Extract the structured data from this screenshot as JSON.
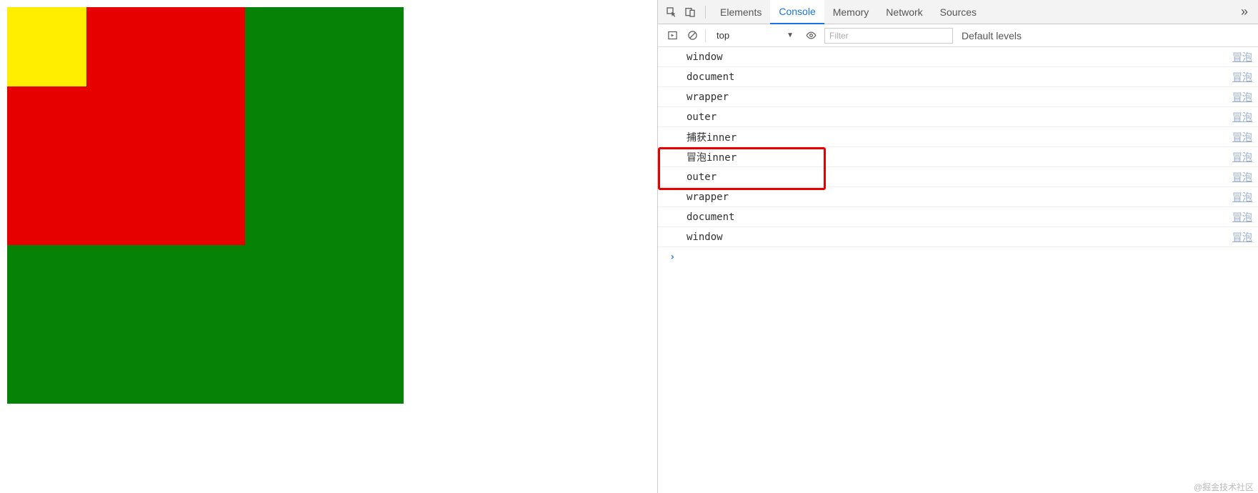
{
  "page": {
    "outer_color": "#068306",
    "mid_color": "#e70000",
    "inner_color": "#ffee00"
  },
  "devtools": {
    "tabs": {
      "elements": "Elements",
      "console": "Console",
      "memory": "Memory",
      "network": "Network",
      "sources": "Sources"
    },
    "toolbar": {
      "context": "top",
      "filter_placeholder": "Filter",
      "levels_label": "Default levels"
    },
    "source_label": "冒泡",
    "messages": [
      "window",
      "document",
      "wrapper",
      "outer",
      "捕获inner",
      "冒泡inner",
      "outer",
      "wrapper",
      "document",
      "window"
    ]
  },
  "watermark": "@掘金技术社区"
}
